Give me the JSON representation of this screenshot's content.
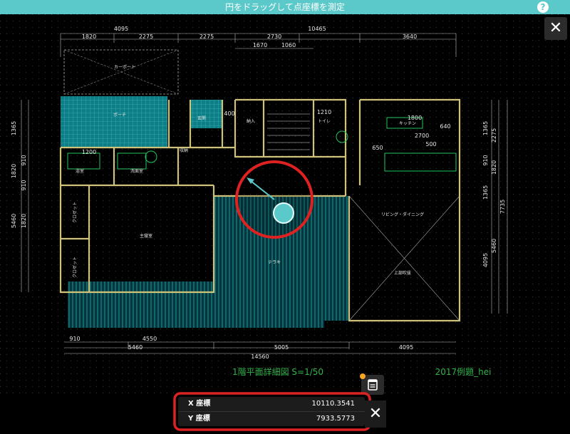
{
  "header": {
    "title": "円をドラッグして点座標を測定",
    "help_label": "?",
    "close_label": "✕"
  },
  "drawing": {
    "caption": "1階平面詳細図 S=1/50",
    "signature": "2017例題_hei",
    "top_dims": [
      "4095",
      "2275",
      "2275",
      "2730",
      "10465",
      "3640",
      "1820"
    ],
    "top_dims2": [
      "1670",
      "1060"
    ],
    "bottom_dims": [
      "910",
      "4550",
      "5460",
      "5005",
      "4095",
      "14560"
    ],
    "left_dims": [
      "1365",
      "910",
      "1820",
      "910",
      "1820",
      "5460"
    ],
    "right_dims": [
      "1365",
      "2275",
      "910",
      "1820",
      "1365",
      "7735",
      "5460",
      "4095"
    ],
    "room_labels": [
      "カーポート",
      "ポーチ",
      "玄関",
      "納入",
      "トイレ",
      "キッチン",
      "浴室",
      "洗面室",
      "収納",
      "主寝室",
      "クロゼット",
      "クロゼット",
      "テラキ",
      "リビング・ダイニング",
      "上部吹抜"
    ],
    "inner_dims": [
      "1210",
      "1200",
      "1800",
      "2700",
      "500",
      "650",
      "640",
      "400"
    ],
    "accent_color": "#5bc8c9",
    "line_color": "#d8d8d8",
    "wall_color": "#cfc27a"
  },
  "measurement": {
    "x_label": "X 座標",
    "x_value": "10110.3541",
    "y_label": "Y 座標",
    "y_value": "7933.5773",
    "close_label": "✕",
    "memo_icon": "memo-icon"
  }
}
